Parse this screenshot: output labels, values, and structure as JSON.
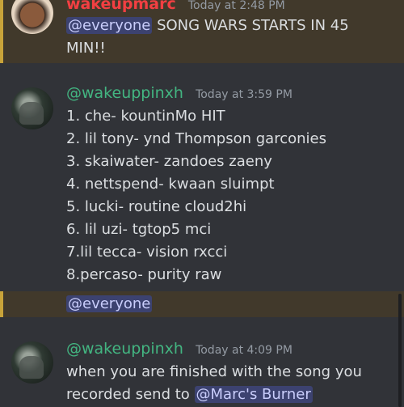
{
  "messages": [
    {
      "username": "wakeupmarc",
      "timestamp": "Today at 2:48 PM",
      "mention": "@everyone",
      "text_line1": " SONG WARS STARTS IN 45",
      "text_line2": "MIN!!"
    },
    {
      "username": "@wakeuppinxh",
      "timestamp": "Today at 3:59 PM",
      "lines": [
        "1. che- kountinMo HIT",
        "2. lil tony- ynd Thompson garconies",
        "3. skaiwater- zandoes zaeny",
        "4. nettspend- kwaan sluimpt",
        "5. lucki- routine cloud2hi",
        "6. lil uzi- tgtop5 mci",
        "7.lil tecca- vision rxcci",
        "8.percaso- purity raw"
      ]
    },
    {
      "mention": "@everyone"
    },
    {
      "username": "@wakeuppinxh",
      "timestamp": "Today at 4:09 PM",
      "text_line1": "when you are finished with the song you",
      "text_line2": "recorded send to ",
      "mention": "@Marc's Burner"
    }
  ]
}
